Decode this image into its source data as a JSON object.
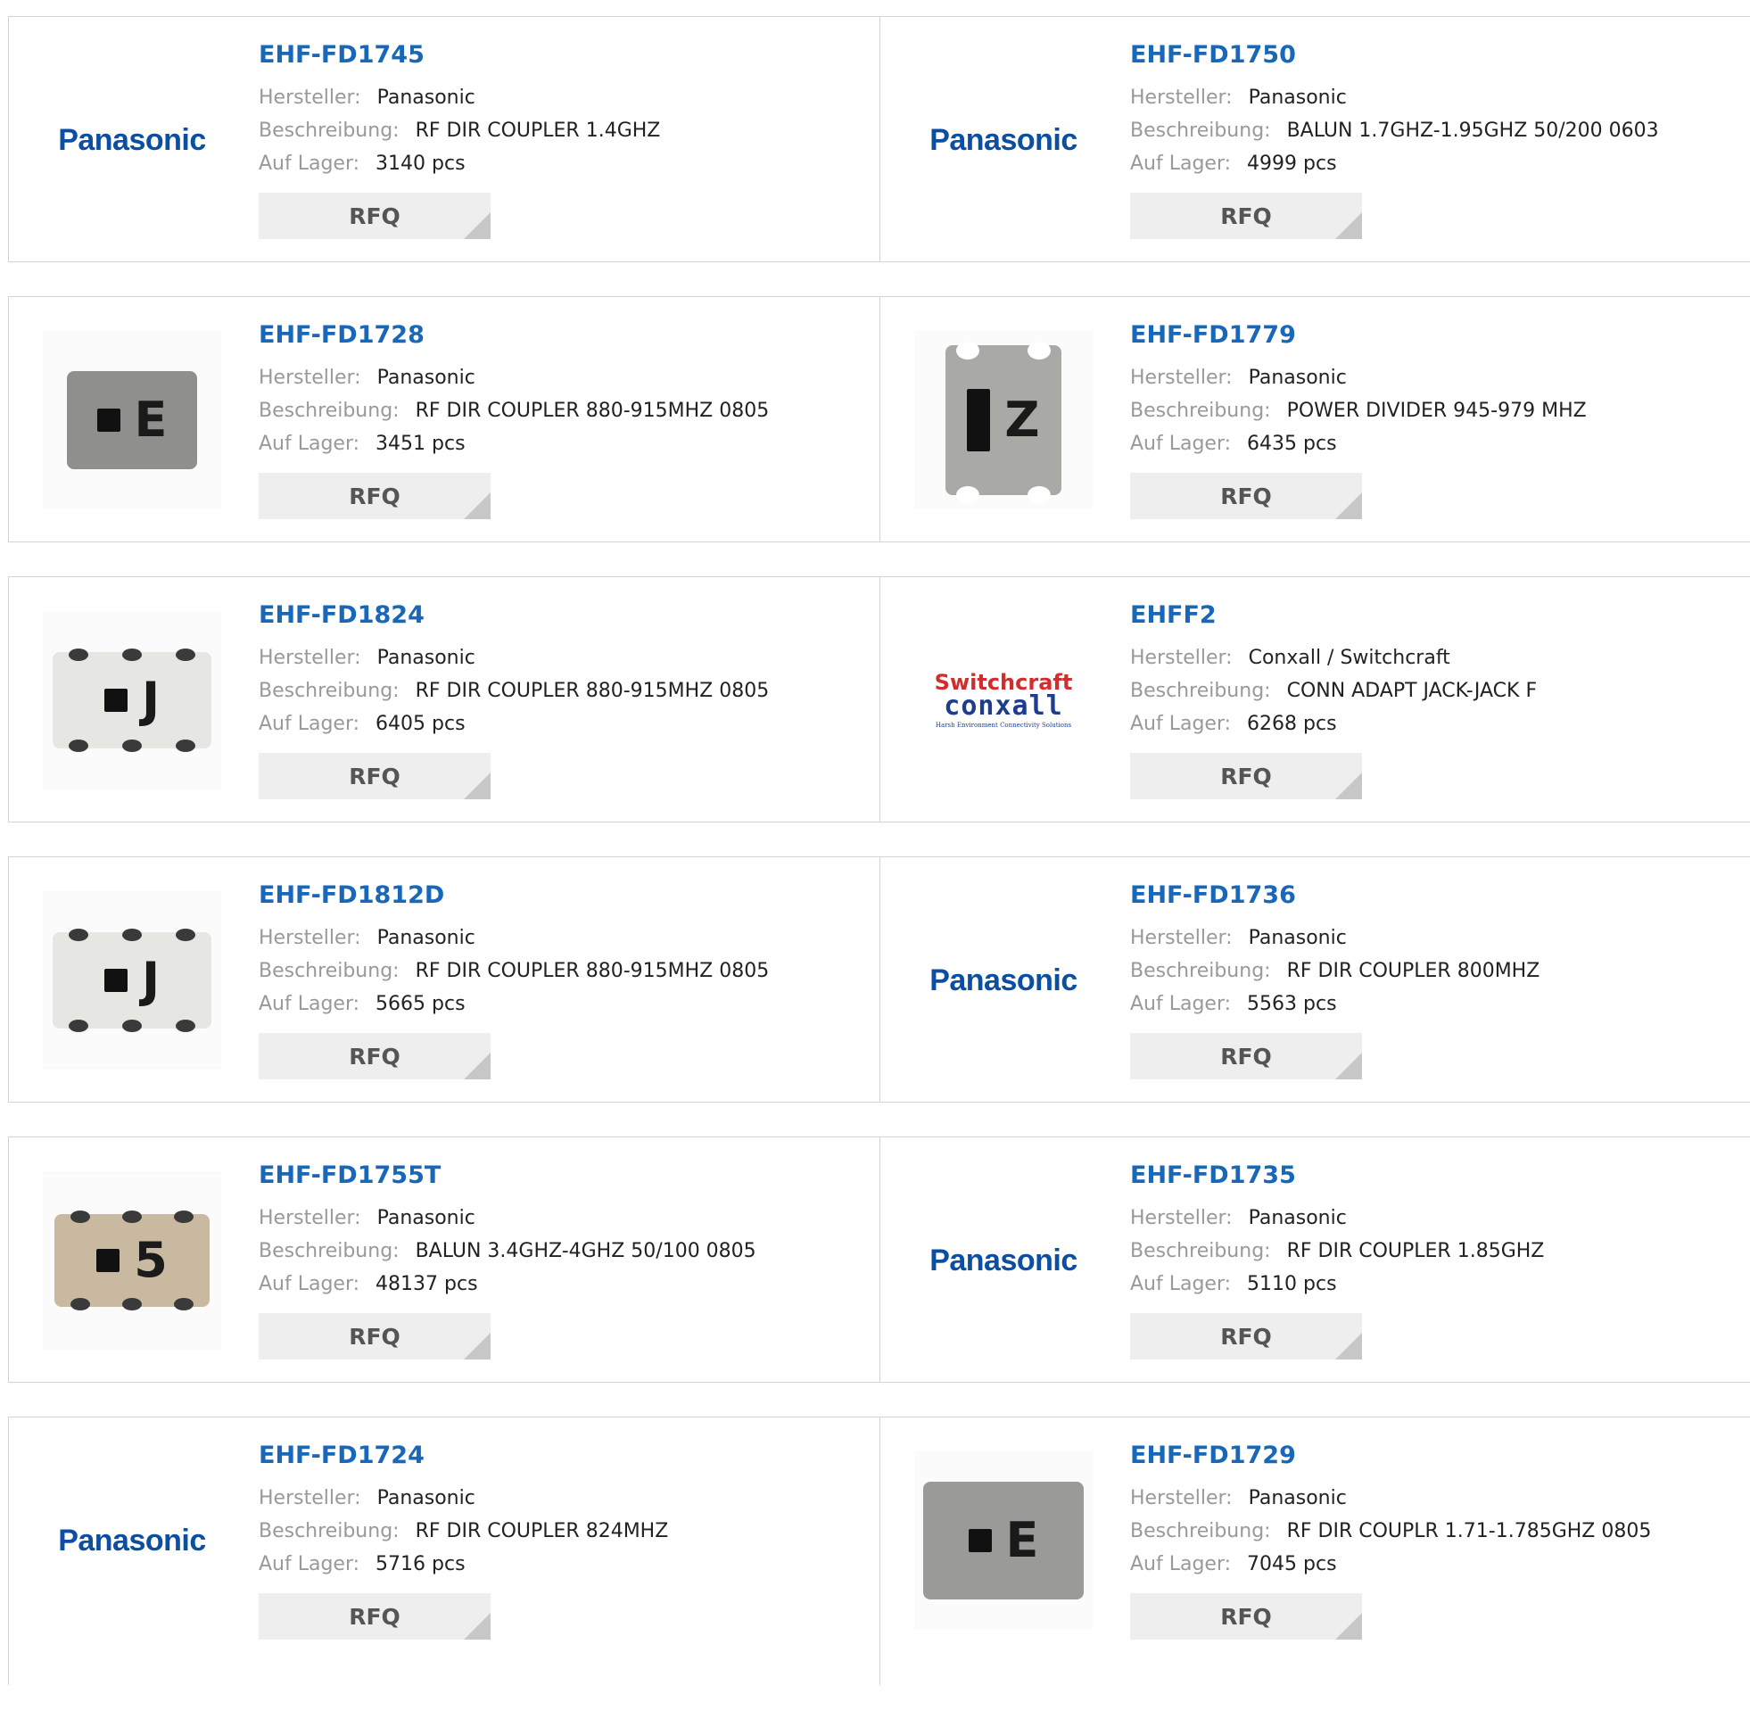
{
  "labels": {
    "manufacturer": "Hersteller:",
    "description": "Beschreibung:",
    "stock": "Auf Lager:",
    "rfq": "RFQ"
  },
  "colors": {
    "link": "#1967b8",
    "panasonic": "#0b4ea2",
    "switchcraft": "#d22d2d",
    "conxall": "#1d3e8c"
  },
  "logos": {
    "panasonic": "Panasonic",
    "switchcraft": "Switchcraft",
    "conxall": "conxall",
    "conxall_tagline": "Harsh Environment Connectivity Solutions"
  },
  "products": [
    {
      "part": "EHF-FD1745",
      "manufacturer": "Panasonic",
      "description": "RF DIR COUPLER 1.4GHZ",
      "stock": "3140 pcs",
      "thumb": "panasonic-logo"
    },
    {
      "part": "EHF-FD1750",
      "manufacturer": "Panasonic",
      "description": "BALUN 1.7GHZ-1.95GHZ 50/200 0603",
      "stock": "4999 pcs",
      "thumb": "panasonic-logo"
    },
    {
      "part": "EHF-FD1728",
      "manufacturer": "Panasonic",
      "description": "RF DIR COUPLER 880-915MHZ 0805",
      "stock": "3451 pcs",
      "thumb": "chip-e",
      "chip_mark": "E"
    },
    {
      "part": "EHF-FD1779",
      "manufacturer": "Panasonic",
      "description": "POWER DIVIDER 945-979 MHZ",
      "stock": "6435 pcs",
      "thumb": "chip-z",
      "chip_mark": "Z"
    },
    {
      "part": "EHF-FD1824",
      "manufacturer": "Panasonic",
      "description": "RF DIR COUPLER 880-915MHZ 0805",
      "stock": "6405 pcs",
      "thumb": "chip-j",
      "chip_mark": "J"
    },
    {
      "part": "EHFF2",
      "manufacturer": "Conxall / Switchcraft",
      "description": "CONN ADAPT JACK-JACK F",
      "stock": "6268 pcs",
      "thumb": "switchcraft-conxall-logo"
    },
    {
      "part": "EHF-FD1812D",
      "manufacturer": "Panasonic",
      "description": "RF DIR COUPLER 880-915MHZ 0805",
      "stock": "5665 pcs",
      "thumb": "chip-j",
      "chip_mark": "J"
    },
    {
      "part": "EHF-FD1736",
      "manufacturer": "Panasonic",
      "description": "RF DIR COUPLER 800MHZ",
      "stock": "5563 pcs",
      "thumb": "panasonic-logo"
    },
    {
      "part": "EHF-FD1755T",
      "manufacturer": "Panasonic",
      "description": "BALUN 3.4GHZ-4GHZ 50/100 0805",
      "stock": "48137 pcs",
      "thumb": "chip-5",
      "chip_mark": "5"
    },
    {
      "part": "EHF-FD1735",
      "manufacturer": "Panasonic",
      "description": "RF DIR COUPLER 1.85GHZ",
      "stock": "5110 pcs",
      "thumb": "panasonic-logo"
    },
    {
      "part": "EHF-FD1724",
      "manufacturer": "Panasonic",
      "description": "RF DIR COUPLER 824MHZ",
      "stock": "5716 pcs",
      "thumb": "panasonic-logo"
    },
    {
      "part": "EHF-FD1729",
      "manufacturer": "Panasonic",
      "description": "RF DIR COUPLR 1.71-1.785GHZ 0805",
      "stock": "7045 pcs",
      "thumb": "chip-e",
      "chip_mark": "E"
    }
  ]
}
